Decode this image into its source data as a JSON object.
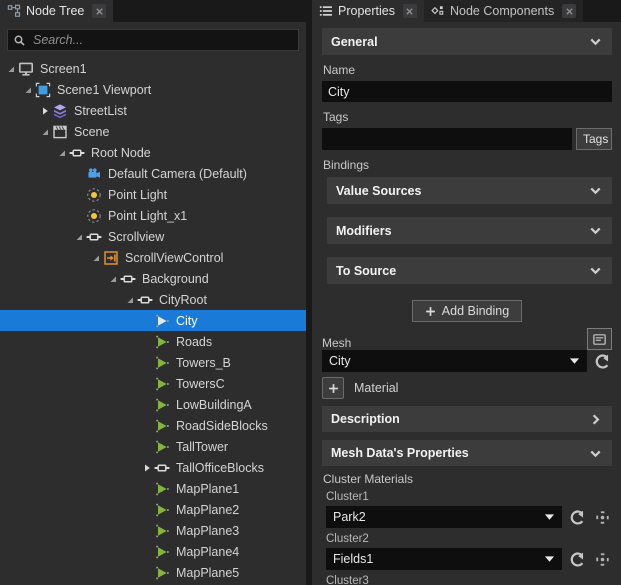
{
  "node_tree_panel": {
    "tab_label": "Node Tree",
    "search_placeholder": "Search...",
    "tree": [
      {
        "label": "Screen1",
        "depth": 0,
        "icon": "screen",
        "expander": "expanded"
      },
      {
        "label": "Scene1 Viewport",
        "depth": 1,
        "icon": "viewport",
        "expander": "expanded"
      },
      {
        "label": "StreetList",
        "depth": 2,
        "icon": "layers",
        "expander": "collapsed"
      },
      {
        "label": "Scene",
        "depth": 2,
        "icon": "scene",
        "expander": "expanded"
      },
      {
        "label": "Root Node",
        "depth": 3,
        "icon": "node",
        "expander": "expanded"
      },
      {
        "label": "Default Camera (Default)",
        "depth": 4,
        "icon": "camera",
        "expander": "none"
      },
      {
        "label": "Point Light",
        "depth": 4,
        "icon": "light",
        "expander": "none"
      },
      {
        "label": "Point Light_x1",
        "depth": 4,
        "icon": "light",
        "expander": "none"
      },
      {
        "label": "Scrollview",
        "depth": 4,
        "icon": "node",
        "expander": "expanded"
      },
      {
        "label": "ScrollViewControl",
        "depth": 5,
        "icon": "scroll-control",
        "expander": "expanded"
      },
      {
        "label": "Background",
        "depth": 6,
        "icon": "node",
        "expander": "expanded"
      },
      {
        "label": "CityRoot",
        "depth": 7,
        "icon": "node",
        "expander": "expanded"
      },
      {
        "label": "City",
        "depth": 8,
        "icon": "mesh",
        "expander": "none",
        "selected": true
      },
      {
        "label": "Roads",
        "depth": 8,
        "icon": "mesh",
        "expander": "none"
      },
      {
        "label": "Towers_B",
        "depth": 8,
        "icon": "mesh",
        "expander": "none"
      },
      {
        "label": "TowersC",
        "depth": 8,
        "icon": "mesh",
        "expander": "none"
      },
      {
        "label": "LowBuildingA",
        "depth": 8,
        "icon": "mesh",
        "expander": "none"
      },
      {
        "label": "RoadSideBlocks",
        "depth": 8,
        "icon": "mesh",
        "expander": "none"
      },
      {
        "label": "TallTower",
        "depth": 8,
        "icon": "mesh",
        "expander": "none"
      },
      {
        "label": "TallOfficeBlocks",
        "depth": 8,
        "icon": "node",
        "expander": "collapsed"
      },
      {
        "label": "MapPlane1",
        "depth": 8,
        "icon": "mesh",
        "expander": "none"
      },
      {
        "label": "MapPlane2",
        "depth": 8,
        "icon": "mesh",
        "expander": "none"
      },
      {
        "label": "MapPlane3",
        "depth": 8,
        "icon": "mesh",
        "expander": "none"
      },
      {
        "label": "MapPlane4",
        "depth": 8,
        "icon": "mesh",
        "expander": "none"
      },
      {
        "label": "MapPlane5",
        "depth": 8,
        "icon": "mesh",
        "expander": "none"
      }
    ]
  },
  "properties_panel": {
    "tabs": [
      {
        "label": "Properties"
      },
      {
        "label": "Node Components"
      }
    ],
    "general": {
      "title": "General",
      "name_label": "Name",
      "name_value": "City",
      "tags_label": "Tags",
      "tags_value": "",
      "tags_button_label": "Tags",
      "bindings_label": "Bindings",
      "binding_sections": [
        "Value Sources",
        "Modifiers",
        "To Source"
      ],
      "add_binding_label": "Add Binding",
      "mesh_label": "Mesh",
      "mesh_value": "City",
      "material_label": "Material"
    },
    "description": {
      "title": "Description"
    },
    "mesh_data": {
      "title": "Mesh Data's Properties",
      "cluster_materials_label": "Cluster Materials",
      "clusters": [
        {
          "label": "Cluster1",
          "value": "Park2"
        },
        {
          "label": "Cluster2",
          "value": "Fields1"
        },
        {
          "label": "Cluster3",
          "value": ""
        }
      ]
    }
  },
  "colors": {
    "selection_blue": "#1a7ad8",
    "mesh_green": "#83b53e",
    "scroll_control_orange": "#e0912f",
    "panel_bg": "#2d2d2d"
  }
}
